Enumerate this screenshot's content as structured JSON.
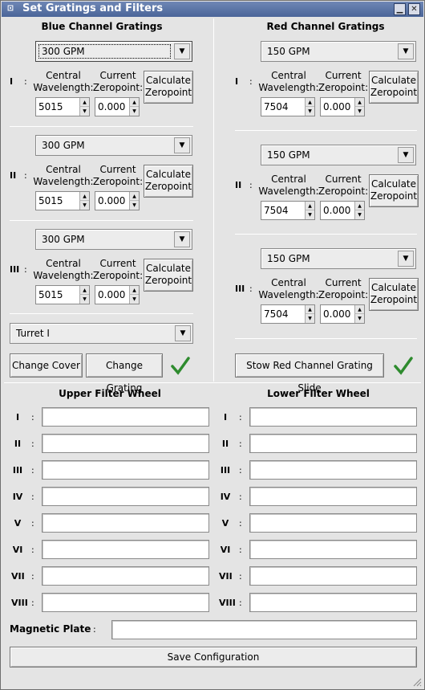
{
  "window": {
    "title": "Set Gratings and Filters"
  },
  "blue": {
    "header": "Blue Channel Gratings",
    "rows": [
      {
        "roman": "I",
        "grating": "300 GPM",
        "wavelength": "5015",
        "zeropoint": "0.000"
      },
      {
        "roman": "II",
        "grating": "300 GPM",
        "wavelength": "5015",
        "zeropoint": "0.000"
      },
      {
        "roman": "III",
        "grating": "300 GPM",
        "wavelength": "5015",
        "zeropoint": "0.000"
      }
    ],
    "turret": "Turret I",
    "change_cover": "Change Cover",
    "change_grating": "Change Grating"
  },
  "red": {
    "header": "Red Channel Gratings",
    "rows": [
      {
        "roman": "I",
        "grating": "150 GPM",
        "wavelength": "7504",
        "zeropoint": "0.000"
      },
      {
        "roman": "II",
        "grating": "150 GPM",
        "wavelength": "7504",
        "zeropoint": "0.000"
      },
      {
        "roman": "III",
        "grating": "150 GPM",
        "wavelength": "7504",
        "zeropoint": "0.000"
      }
    ],
    "stow": "Stow Red Channel Grating Slide"
  },
  "labels": {
    "central": "Central",
    "wavelength": "Wavelength:",
    "current": "Current",
    "zeropoint": "Zeropoint:",
    "calc1": "Calculate",
    "calc2": "Zeropoint",
    "colon": ":"
  },
  "filters": {
    "upper_header": "Upper Filter Wheel",
    "lower_header": "Lower Filter Wheel",
    "positions": [
      "I",
      "II",
      "III",
      "IV",
      "V",
      "VI",
      "VII",
      "VIII"
    ],
    "upper_values": [
      "",
      "",
      "",
      "",
      "",
      "",
      "",
      ""
    ],
    "lower_values": [
      "",
      "",
      "",
      "",
      "",
      "",
      "",
      ""
    ]
  },
  "magnetic_plate": {
    "label": "Magnetic Plate",
    "value": ""
  },
  "save": "Save Configuration",
  "colors": {
    "title_bar": "#4a6599",
    "check": "#2e8b2e"
  }
}
